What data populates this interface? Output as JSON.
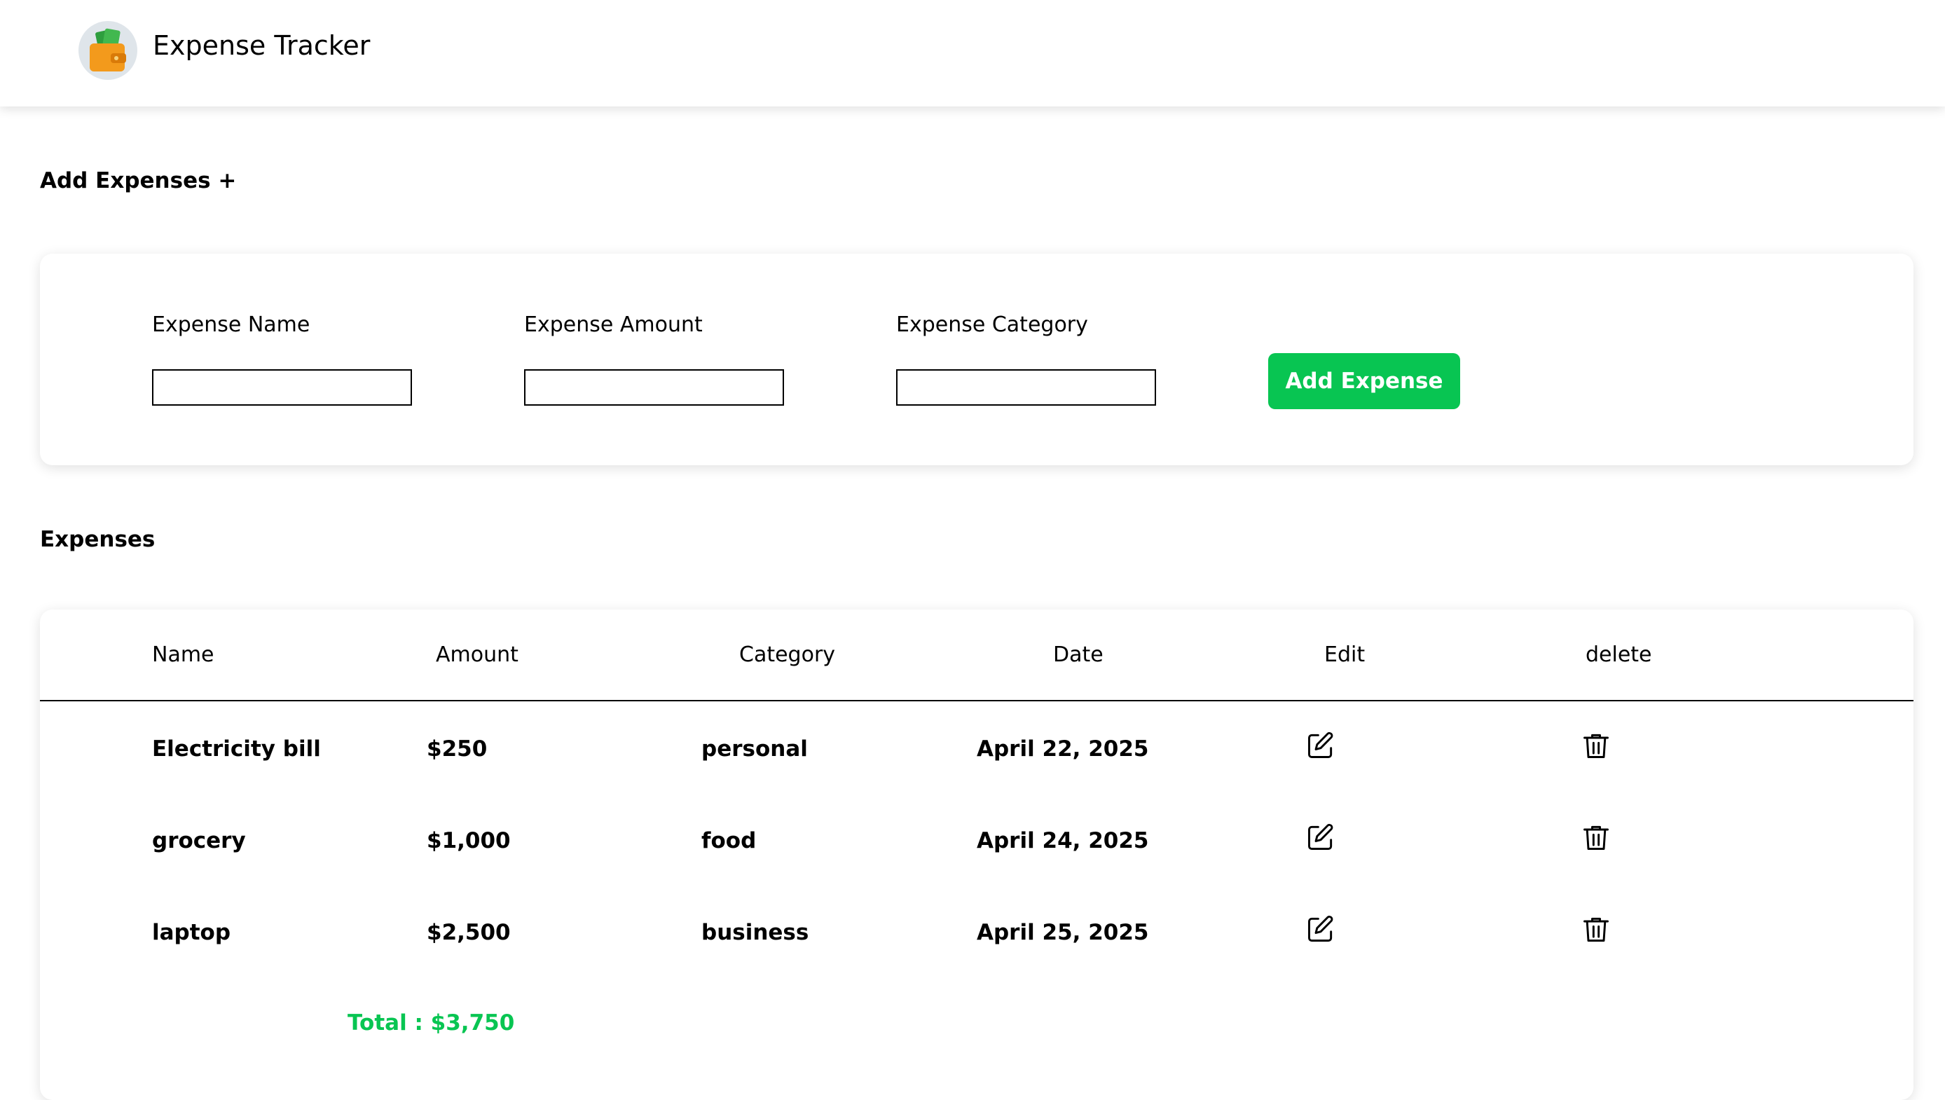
{
  "header": {
    "title": "Expense Tracker",
    "logo_icon": "wallet-icon"
  },
  "add_section": {
    "heading": "Add Expenses +",
    "fields": [
      {
        "label": "Expense Name",
        "value": "",
        "placeholder": ""
      },
      {
        "label": "Expense Amount",
        "value": "",
        "placeholder": ""
      },
      {
        "label": "Expense Category",
        "value": "",
        "placeholder": ""
      }
    ],
    "button_label": "Add Expense",
    "accent_color": "#08c552"
  },
  "expenses_section": {
    "heading": "Expenses",
    "columns": [
      "Name",
      "Amount",
      "Category",
      "Date",
      "Edit",
      "delete"
    ],
    "rows": [
      {
        "name": "Electricity bill",
        "amount": "$250",
        "category": "personal",
        "date": "April 22, 2025",
        "edit_icon": "edit-icon",
        "delete_icon": "trash-icon"
      },
      {
        "name": "grocery",
        "amount": "$1,000",
        "category": "food",
        "date": "April 24, 2025",
        "edit_icon": "edit-icon",
        "delete_icon": "trash-icon"
      },
      {
        "name": "laptop",
        "amount": "$2,500",
        "category": "business",
        "date": "April 25, 2025",
        "edit_icon": "edit-icon",
        "delete_icon": "trash-icon"
      }
    ],
    "total": "Total : $3,750"
  }
}
